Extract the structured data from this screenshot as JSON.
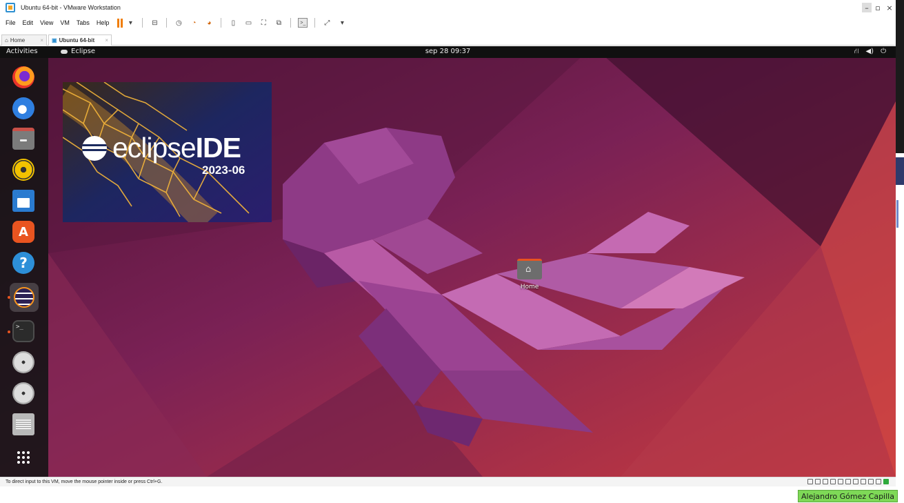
{
  "window": {
    "title": "Ubuntu 64-bit - VMware Workstation",
    "minimize_glyph": "–",
    "maximize_glyph": "▫",
    "close_glyph": "×"
  },
  "menubar": {
    "items": [
      "File",
      "Edit",
      "View",
      "VM",
      "Tabs",
      "Help"
    ]
  },
  "tabs": [
    {
      "label": "Home",
      "close": "×"
    },
    {
      "label": "Ubuntu 64-bit",
      "close": "×"
    }
  ],
  "ubuntu": {
    "activities": "Activities",
    "focused_app": "Eclipse",
    "clock": "sep 28  09:37",
    "tray": {
      "network_glyph": "⛙",
      "volume_glyph": "◀)",
      "power_glyph": "⏻"
    }
  },
  "dock": {
    "apps": [
      {
        "name": "firefox-icon",
        "glyph": ""
      },
      {
        "name": "thunderbird-icon",
        "glyph": ""
      },
      {
        "name": "files-icon",
        "glyph": ""
      },
      {
        "name": "rhythmbox-icon",
        "glyph": ""
      },
      {
        "name": "libreoffice-writer-icon",
        "glyph": ""
      },
      {
        "name": "software-center-icon",
        "glyph": "A"
      },
      {
        "name": "help-icon",
        "glyph": "?"
      },
      {
        "name": "eclipse-icon",
        "glyph": ""
      },
      {
        "name": "terminal-icon",
        "glyph": ">_"
      },
      {
        "name": "cd-drive-icon",
        "glyph": ""
      },
      {
        "name": "cd-drive-icon-2",
        "glyph": ""
      },
      {
        "name": "floppy-icon",
        "glyph": ""
      },
      {
        "name": "show-apps-icon",
        "glyph": "⋮⋮⋮"
      }
    ]
  },
  "splash": {
    "brand": "eclipse",
    "product": "IDE",
    "version": "2023-06"
  },
  "desktop": {
    "home_label": "Home"
  },
  "statusbar": {
    "hint": "To direct input to this VM, move the mouse pointer inside or press Ctrl+G."
  },
  "overlay": {
    "user_name": "Alejandro Gómez Capilla"
  },
  "colors": {
    "ubuntu_orange": "#e95420",
    "vmware_pause": "#f07d00",
    "wallpaper_dark": "#5a1a45",
    "wallpaper_light": "#c2314a",
    "name_tag": "#7ed957"
  }
}
